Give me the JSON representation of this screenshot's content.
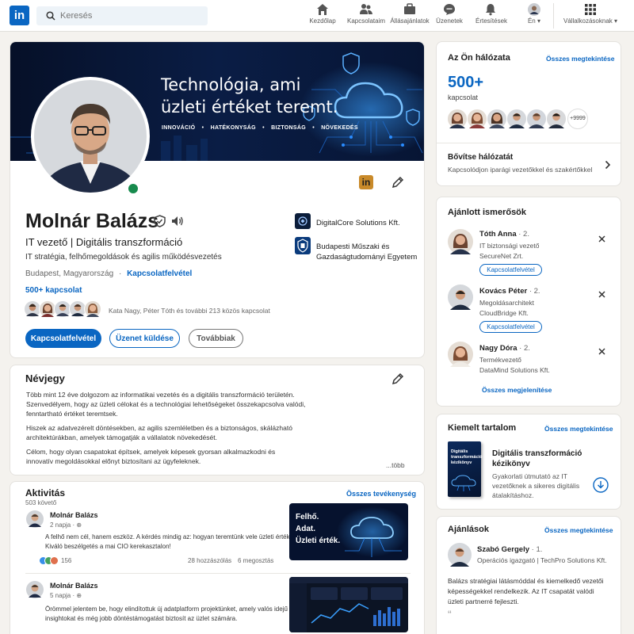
{
  "nav": {
    "search_placeholder": "Keresés",
    "items": [
      {
        "label": "Kezdőlap",
        "icon": "home-icon"
      },
      {
        "label": "Kapcsolataim",
        "icon": "network-icon"
      },
      {
        "label": "Állásajánlatok",
        "icon": "briefcase-icon"
      },
      {
        "label": "Üzenetek",
        "icon": "messaging-icon"
      },
      {
        "label": "Értesítések",
        "icon": "bell-icon"
      },
      {
        "label": "Én",
        "icon": "avatar"
      },
      {
        "label": "Vállalkozásoknak",
        "icon": "grid-icon"
      }
    ]
  },
  "banner": {
    "headline1": "Technológia, ami",
    "headline2": "üzleti értéket teremt.",
    "tags": [
      "INNOVÁCIÓ",
      "HATÉKONYSÁG",
      "BIZTONSÁG",
      "NÖVEKEDÉS"
    ]
  },
  "profile": {
    "name": "Molnár Balázs",
    "headline": "IT vezető | Digitális transzformáció",
    "subheadline": "IT stratégia, felhőmegoldások és agilis működésvezetés",
    "location": "Budapest, Magyarország",
    "contact_link": "Kapcsolatfelvétel",
    "connections": "500+ kapcsolat",
    "mutual": "Kata Nagy, Péter Tóth és további 213 közös kapcsolat",
    "company": "DigitalCore Solutions Kft.",
    "school_line1": "Budapesti Műszaki és",
    "school_line2": "Gazdaságtudományi Egyetem",
    "btn_connect": "Kapcsolatfelvétel",
    "btn_message": "Üzenet küldése",
    "btn_more": "Továbbiak"
  },
  "about": {
    "title": "Névjegy",
    "p1_l1": "Több mint 12 éve dolgozom az informatikai vezetés és a digitális transzformáció területén.",
    "p1_l2": "Szenvedélyem, hogy az üzleti célokat és a technológiai lehetőségeket összekapcsolva valódi,",
    "p1_l3": "fenntartható értéket teremtsek.",
    "p2_l1": "Hiszek az adatvezérelt döntésekben, az agilis szemléletben és a biztonságos, skálázható",
    "p2_l2": "architektúrákban, amelyek támogatják a vállalatok növekedését.",
    "p3_l1": "Célom, hogy olyan csapatokat építsek, amelyek képesek gyorsan alkalmazkodni és",
    "p3_l2": "innovatív megoldásokkal előnyt biztosítani az ügyfeleknek.",
    "more": "...több"
  },
  "activity": {
    "title": "Aktivitás",
    "followers": "503 követő",
    "all_link": "Összes tevékenység",
    "posts": [
      {
        "author": "Molnár Balázs",
        "time": "2 napja",
        "text_l1": "A felhő nem cél, hanem eszköz. A kérdés mindig az: hogyan teremtünk vele üzleti értéket?",
        "text_l2": "Kiváló beszélgetés a mai CIO kerekasztalon!",
        "reactions": "156",
        "comments": "28 hozzászólás",
        "shares": "6 megosztás",
        "thumb_l1": "Felhő.",
        "thumb_l2": "Adat.",
        "thumb_l3": "Üzleti érték."
      },
      {
        "author": "Molnár Balázs",
        "time": "5 napja",
        "text_l1": "Örömmel jelentem be, hogy elindítottuk új adatplatform projektünket, amely valós idejű",
        "text_l2": "insightokat és még jobb döntéstámogatást biztosít az üzlet számára."
      }
    ]
  },
  "network": {
    "title": "Az Ön hálózata",
    "all_link": "Összes megtekintése",
    "count": "500+",
    "count_label": "kapcsolat",
    "more_badge": "+9999",
    "expand_title": "Bővítse hálózatát",
    "expand_sub": "Kapcsolódjon iparági vezetőkkel és szakértőkkel"
  },
  "suggestions": {
    "title": "Ajánlott ismerősök",
    "people": [
      {
        "name": "Tóth Anna",
        "degree": "· 2.",
        "role": "IT biztonsági vezető",
        "company": "SecureNet Zrt.",
        "btn": "Kapcsolatfelvétel"
      },
      {
        "name": "Kovács Péter",
        "degree": "· 2.",
        "role": "Megoldásarchitekt",
        "company": "CloudBridge Kft.",
        "btn": "Kapcsolatfelvétel"
      },
      {
        "name": "Nagy Dóra",
        "degree": "· 2.",
        "role": "Termékvezető",
        "company": "DataMind Solutions Kft."
      }
    ],
    "show_all": "Összes megjelenítése"
  },
  "featured": {
    "title": "Kiemelt tartalom",
    "all_link": "Összes megtekintése",
    "item_title_l1": "Digitális transzformáció",
    "item_title_l2": "kézikönyv",
    "item_desc_l1": "Gyakorlati útmutató az IT",
    "item_desc_l2": "vezetőknek a sikeres digitális",
    "item_desc_l3": "átalakításhoz.",
    "book_title_l1": "Digitális",
    "book_title_l2": "transzformáció",
    "book_title_l3": "kézikönyv"
  },
  "recommendations": {
    "title": "Ajánlások",
    "all_link": "Összes megtekintése",
    "name": "Szabó Gergely",
    "degree": "· 1.",
    "role": "Operációs igazgató | TechPro Solutions Kft.",
    "text_l1": "Balázs stratégiai látásmóddal és kiemelkedő vezetői",
    "text_l2": "képességekkel rendelkezik. Az IT csapatát valódi",
    "text_l3": "üzleti partnerré fejleszti."
  },
  "colors": {
    "accent": "#0a66c2",
    "background": "#f4f2ee",
    "banner_dark": "#06122e",
    "online": "#178a4d"
  }
}
